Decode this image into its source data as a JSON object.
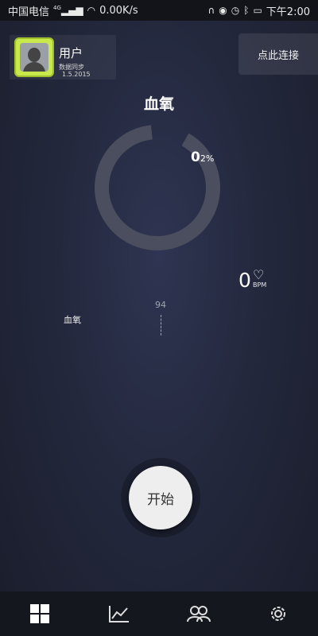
{
  "status_bar": {
    "carrier": "中国电信",
    "network": "4G",
    "speed": "0.00K/s",
    "time": "下午2:00"
  },
  "user": {
    "name": "用户",
    "sync_label": "数据同步",
    "sync_date": "1.5.2015"
  },
  "connect": {
    "label": "点此连接"
  },
  "title": "血氧",
  "oxygen": {
    "value": "0",
    "sub": "2",
    "unit": "%",
    "ring_fraction": 0.9
  },
  "heart_rate": {
    "value": "0",
    "unit": "BPM"
  },
  "chart": {
    "series_label": "血氧",
    "marker_value": "94"
  },
  "start_button": {
    "label": "开始"
  },
  "nav": {
    "items": [
      {
        "icon": "dashboard-grid-icon"
      },
      {
        "icon": "trend-chart-icon"
      },
      {
        "icon": "users-icon"
      },
      {
        "icon": "gear-icon"
      }
    ]
  }
}
